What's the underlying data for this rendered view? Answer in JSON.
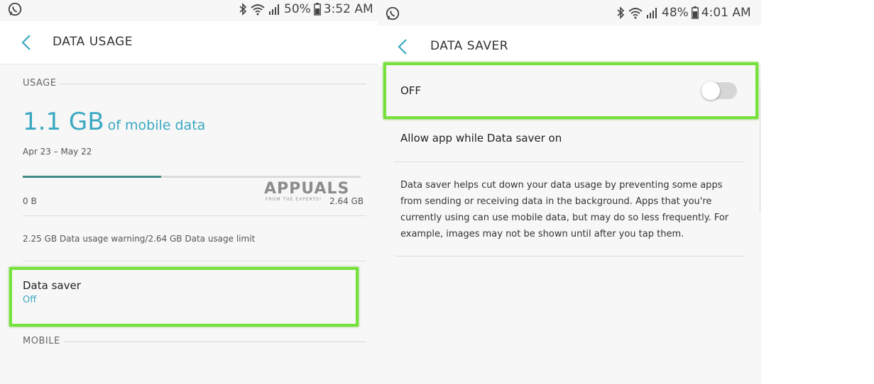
{
  "left_screen": {
    "status_bar": {
      "battery_text": "50%",
      "time": "3:52 AM"
    },
    "app_bar": {
      "title": "DATA USAGE"
    },
    "usage": {
      "section_label": "USAGE",
      "amount": "1.1 GB",
      "amount_suffix": "of mobile data",
      "date_range": "Apr 23 – May 22",
      "bar_start_label": "0 B",
      "bar_end_label": "2.64 GB",
      "used_fraction": 0.41,
      "limits_text": "2.25 GB Data usage warning/2.64 GB Data usage limit"
    },
    "data_saver_row": {
      "title": "Data saver",
      "status": "Off"
    },
    "mobile_section_label": "MOBILE",
    "watermark": {
      "brand": "APPUALS",
      "tagline": "FROM THE EXPERTS!"
    }
  },
  "right_screen": {
    "status_bar": {
      "battery_text": "48%",
      "time": "4:01 AM"
    },
    "app_bar": {
      "title": "DATA SAVER"
    },
    "toggle_row": {
      "label": "OFF",
      "enabled": false
    },
    "allow_row": {
      "label": "Allow app while Data saver on"
    },
    "description": "Data saver helps cut down your data usage by preventing some apps from sending or receiving data in the background. Apps that you're currently using can use mobile data, but may do so less frequently. For example, images may not be shown until after you tap them."
  },
  "colors": {
    "accent": "#3aa8c1",
    "highlight": "#76e13b",
    "bar_fill": "#3f8a87"
  },
  "icons": [
    "whatsapp-icon",
    "bluetooth-icon",
    "wifi-icon",
    "signal-icon",
    "battery-icon",
    "back-arrow-icon"
  ]
}
